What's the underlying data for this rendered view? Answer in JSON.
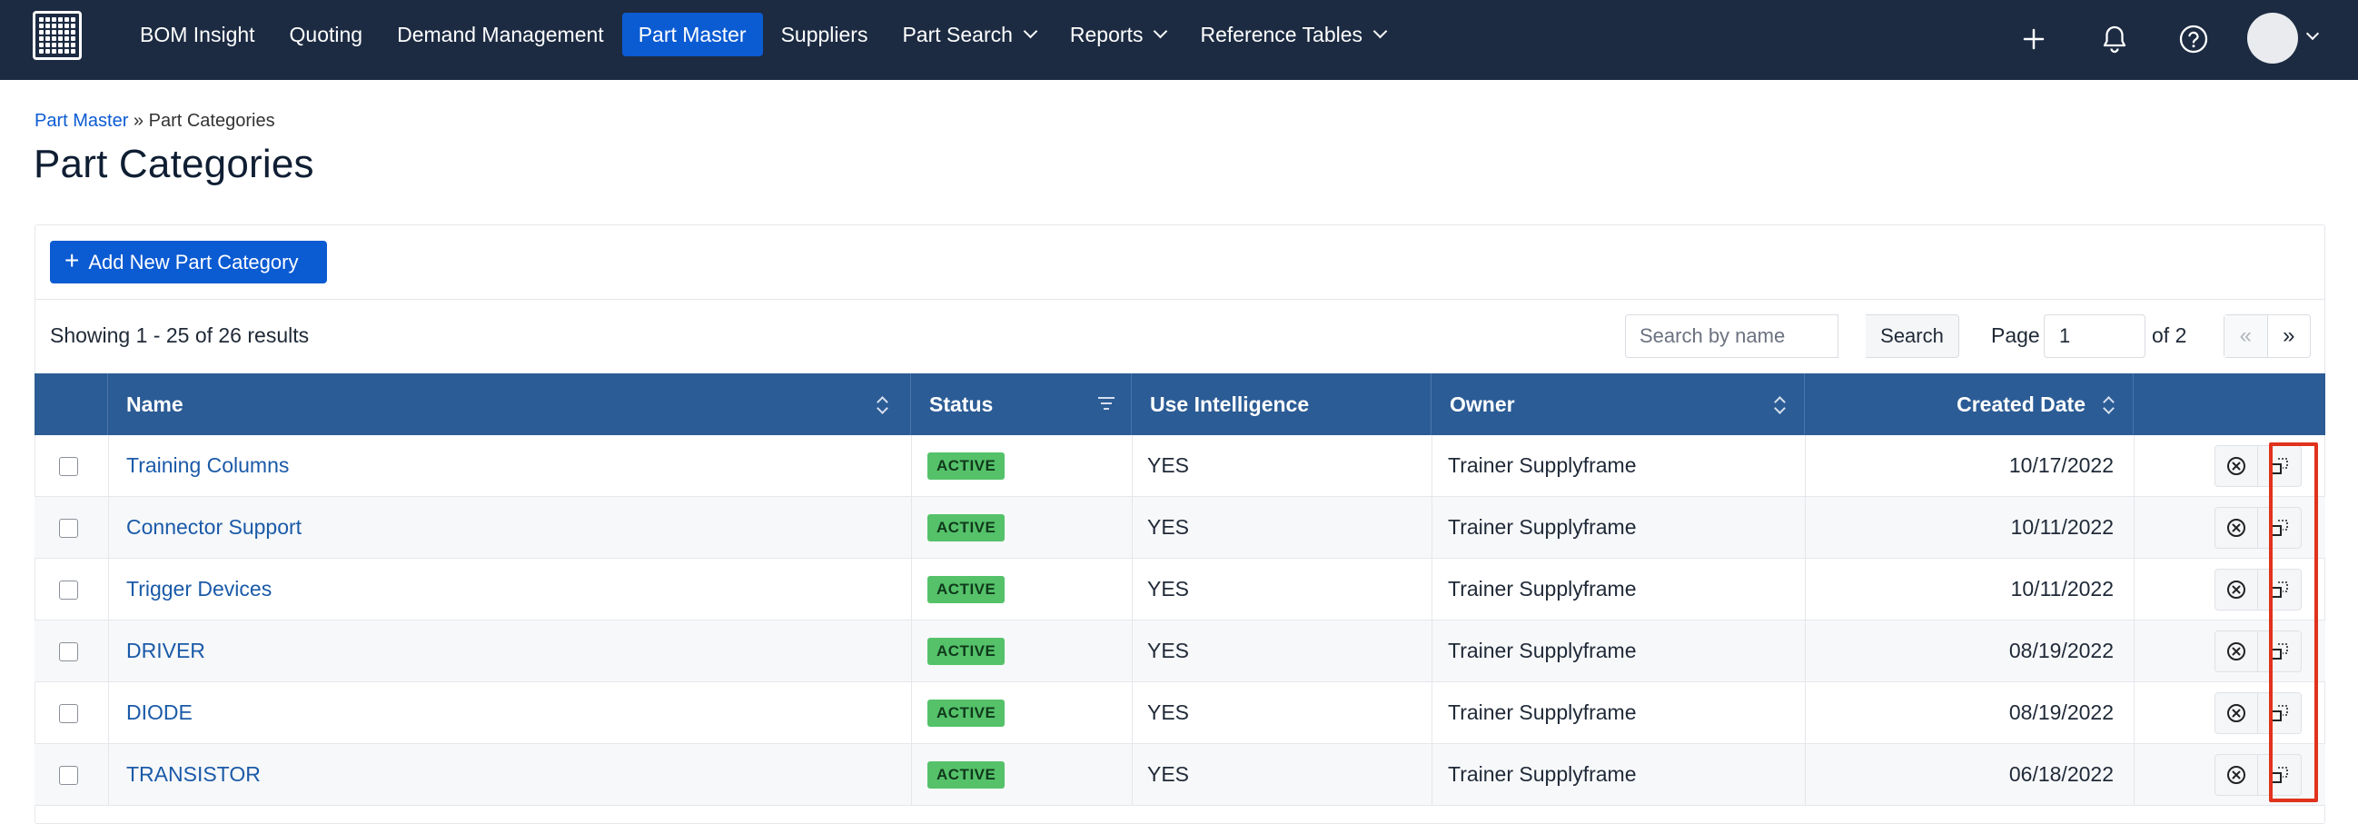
{
  "nav": {
    "items": [
      {
        "label": "BOM Insight",
        "dropdown": false,
        "active": false
      },
      {
        "label": "Quoting",
        "dropdown": false,
        "active": false
      },
      {
        "label": "Demand Management",
        "dropdown": false,
        "active": false
      },
      {
        "label": "Part Master",
        "dropdown": false,
        "active": true
      },
      {
        "label": "Suppliers",
        "dropdown": false,
        "active": false
      },
      {
        "label": "Part Search",
        "dropdown": true,
        "active": false
      },
      {
        "label": "Reports",
        "dropdown": true,
        "active": false
      },
      {
        "label": "Reference Tables",
        "dropdown": true,
        "active": false
      }
    ],
    "icons": [
      "plus-icon",
      "bell-icon",
      "help-icon",
      "avatar"
    ]
  },
  "breadcrumb": {
    "parent": "Part Master",
    "separator": "»",
    "current": "Part Categories"
  },
  "page": {
    "title": "Part Categories"
  },
  "toolbar": {
    "add_label": "Add New Part Category",
    "showing": "Showing 1 - 25 of 26 results",
    "search_placeholder": "Search by name",
    "search_label": "Search",
    "page_label": "Page",
    "page_value": "1",
    "page_of": "of 2",
    "prev_label": "«",
    "next_label": "»"
  },
  "table": {
    "columns": {
      "name": "Name",
      "status": "Status",
      "use_intelligence": "Use Intelligence",
      "owner": "Owner",
      "created_date": "Created Date"
    },
    "rows": [
      {
        "name": "Training Columns",
        "status": "ACTIVE",
        "use_intelligence": "YES",
        "owner": "Trainer Supplyframe",
        "created_date": "10/17/2022"
      },
      {
        "name": "Connector Support",
        "status": "ACTIVE",
        "use_intelligence": "YES",
        "owner": "Trainer Supplyframe",
        "created_date": "10/11/2022"
      },
      {
        "name": "Trigger Devices",
        "status": "ACTIVE",
        "use_intelligence": "YES",
        "owner": "Trainer Supplyframe",
        "created_date": "10/11/2022"
      },
      {
        "name": "DRIVER",
        "status": "ACTIVE",
        "use_intelligence": "YES",
        "owner": "Trainer Supplyframe",
        "created_date": "08/19/2022"
      },
      {
        "name": "DIODE",
        "status": "ACTIVE",
        "use_intelligence": "YES",
        "owner": "Trainer Supplyframe",
        "created_date": "08/19/2022"
      },
      {
        "name": "TRANSISTOR",
        "status": "ACTIVE",
        "use_intelligence": "YES",
        "owner": "Trainer Supplyframe",
        "created_date": "06/18/2022"
      }
    ]
  },
  "colors": {
    "nav_bg": "#1c2b42",
    "primary": "#0b5bd3",
    "table_header": "#2c5c95",
    "active_badge": "#55c26a",
    "highlight": "#e0321c"
  }
}
